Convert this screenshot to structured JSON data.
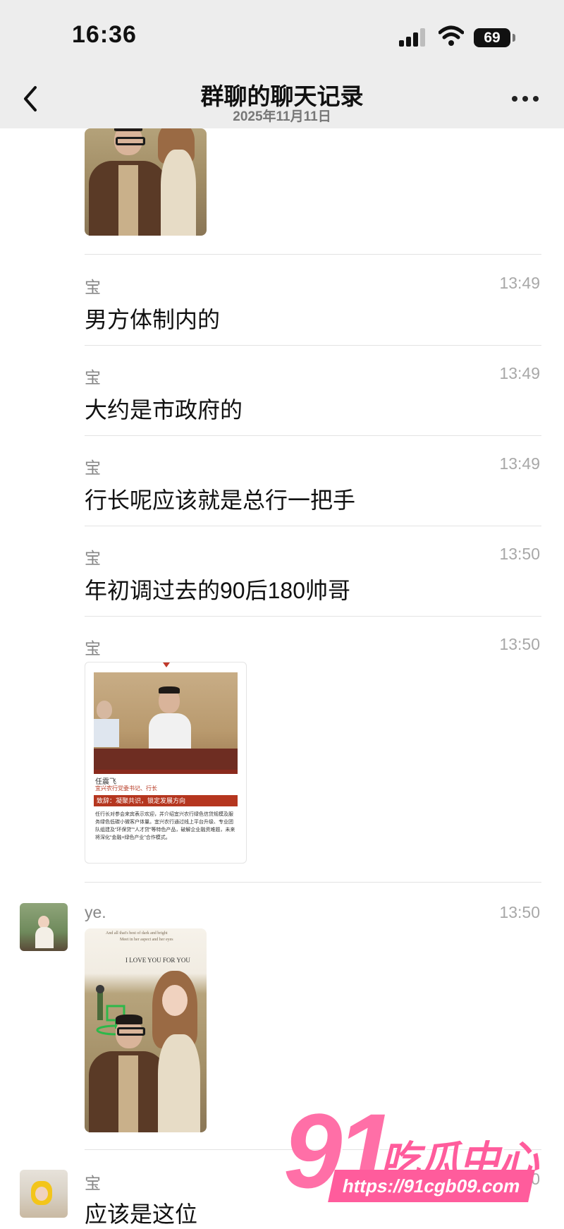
{
  "status_bar": {
    "time": "16:36",
    "battery": "69"
  },
  "nav": {
    "title": "群聊的聊天记录",
    "subtitle": "2025年11月11日"
  },
  "photo1": {
    "alt_label": "wedding-photo"
  },
  "messages": [
    {
      "sender": "宝",
      "time": "13:49",
      "text": "男方体制内的"
    },
    {
      "sender": "宝",
      "time": "13:49",
      "text": "大约是市政府的"
    },
    {
      "sender": "宝",
      "time": "13:49",
      "text": "行长呢应该就是总行一把手"
    },
    {
      "sender": "宝",
      "time": "13:50",
      "text": "年初调过去的90后180帅哥"
    },
    {
      "sender": "宝",
      "time": "13:50"
    },
    {
      "sender": "ye.",
      "time": "13:50"
    },
    {
      "sender": "宝",
      "time": "13:50",
      "text": "应该是这位"
    }
  ],
  "news_card": {
    "name": "任震飞",
    "role": "宜兴农行党委书记、行长",
    "heading": "致辞：凝聚共识，锁定发展方向",
    "body": "任行长对参会来宾表示欢迎，并介绍宜兴农行绿色信贷规模及服务绿色低碳小微客户体量。宜兴农行通过线上平台升级、专业团队组建及“环保贷”“人才贷”等特色产品，破解企业融资难题，未来将深化“金融+绿色产业”合作模式。"
  },
  "wedding_card": {
    "line1": "And all that's best of dark and bright",
    "line2": "Meet in her aspect and her eyes",
    "caption": "I LOVE YOU FOR YOU"
  },
  "watermark": {
    "number": "91",
    "text": "吃瓜中心",
    "url": "https://91cgb09.com"
  }
}
